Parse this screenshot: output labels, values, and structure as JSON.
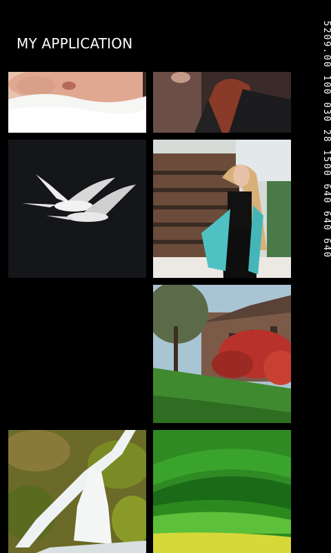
{
  "app": {
    "title": "MY APPLICATION"
  },
  "debug": {
    "frame_counter": "5209.00 100 030 28 1500 640 640 640"
  },
  "gallery": {
    "tiles": [
      {
        "icon": "baby-face-photo"
      },
      {
        "icon": "red-hair-woman-photo"
      },
      {
        "icon": "swans-flying-photo"
      },
      {
        "icon": "fashion-model-photo"
      },
      {
        "icon": "empty-tile"
      },
      {
        "icon": "red-ivy-building-photo"
      },
      {
        "icon": "waterfall-moss-photo"
      },
      {
        "icon": "green-hills-photo"
      }
    ]
  }
}
